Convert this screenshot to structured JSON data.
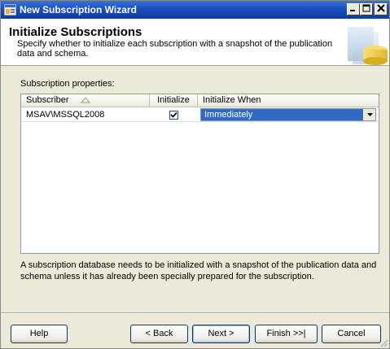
{
  "window": {
    "title": "New Subscription Wizard"
  },
  "header": {
    "title": "Initialize Subscriptions",
    "description": "Specify whether to initialize each subscription with a snapshot of the publication data and schema."
  },
  "subscription_properties": {
    "label": "Subscription properties:",
    "columns": {
      "subscriber": "Subscriber",
      "initialize": "Initialize",
      "initialize_when": "Initialize When"
    },
    "rows": [
      {
        "subscriber": "MSAV\\MSSQL2008",
        "initialize": true,
        "initialize_when": "Immediately"
      }
    ]
  },
  "note": "A subscription database needs to be initialized with a snapshot of the publication data and schema unless it has already been specially prepared for the subscription.",
  "buttons": {
    "help": "Help",
    "back": "< Back",
    "next": "Next >",
    "finish": "Finish >>|",
    "cancel": "Cancel"
  },
  "colors": {
    "titlebar": "#0a3ca8",
    "selection": "#316ac5",
    "window_bg": "#ece9d8"
  }
}
